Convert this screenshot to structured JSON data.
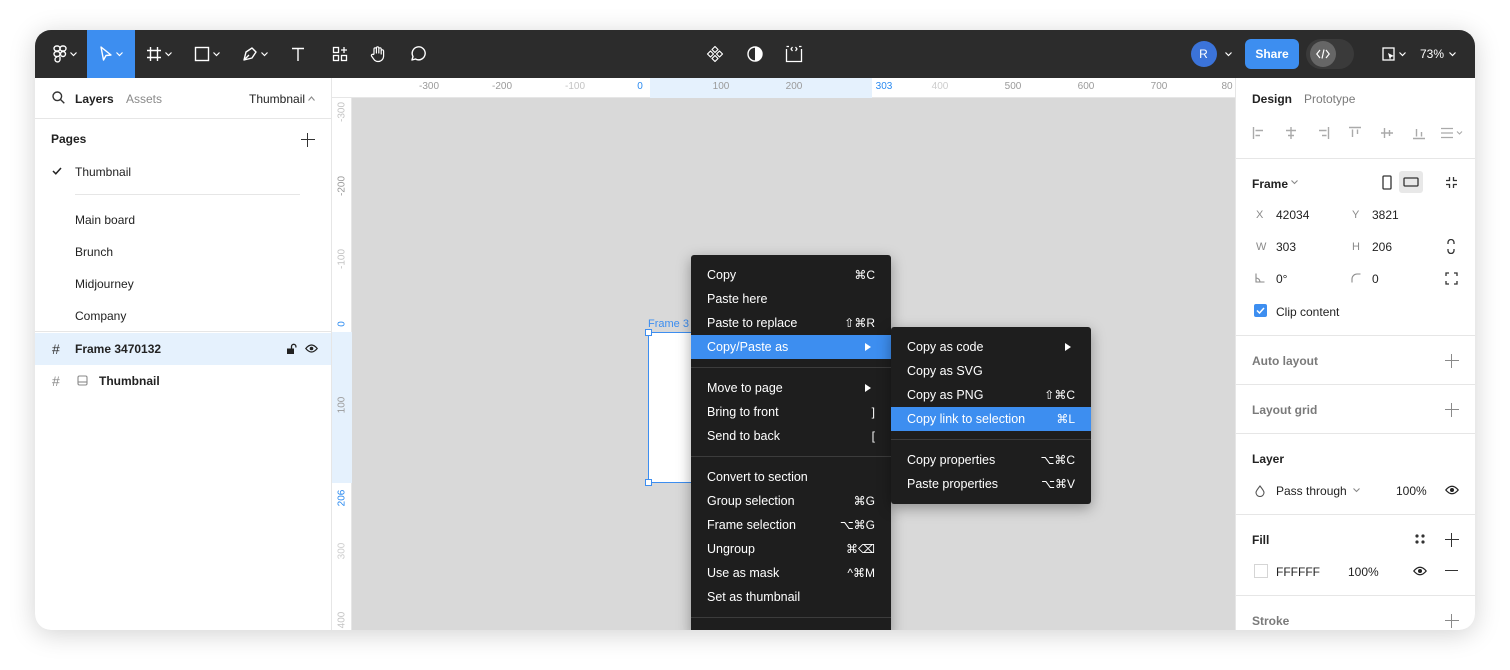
{
  "toolbar": {
    "tools": [
      "figma-menu-icon",
      "move-tool-icon",
      "frame-tool-icon",
      "shape-tool-icon",
      "pen-tool-icon",
      "text-tool-icon",
      "resources-icon",
      "hand-tool-icon",
      "comment-tool-icon"
    ],
    "center": [
      "components-icon",
      "contrast-icon",
      "code-layout-icon"
    ],
    "avatar_initial": "R",
    "share_label": "Share",
    "zoom": "73%"
  },
  "left_panel": {
    "tabs": {
      "layers": "Layers",
      "assets": "Assets",
      "page_selector": "Thumbnail"
    },
    "pages_title": "Pages",
    "pages": [
      "Thumbnail",
      "Main board",
      "Brunch",
      "Midjourney",
      "Company"
    ],
    "current_page": "Thumbnail",
    "layers": [
      {
        "name": "Frame 3470132",
        "selected": true
      },
      {
        "name": "Thumbnail",
        "selected": false
      }
    ]
  },
  "rulers": {
    "top": [
      "-300",
      "-200",
      "-100",
      "0",
      "100",
      "200",
      "303",
      "400",
      "500",
      "600",
      "700",
      "80"
    ],
    "left": [
      "-300",
      "-200",
      "-100",
      "0",
      "100",
      "206",
      "300",
      "400"
    ]
  },
  "canvas": {
    "frame_label": "Frame 3"
  },
  "context_menu": {
    "items": [
      {
        "label": "Copy",
        "shortcut": "⌘C"
      },
      {
        "label": "Paste here",
        "shortcut": ""
      },
      {
        "label": "Paste to replace",
        "shortcut": "⇧⌘R"
      },
      {
        "label": "Copy/Paste as",
        "shortcut": "",
        "submenu": true,
        "highlighted": true
      },
      {
        "label": "Move to page",
        "shortcut": "",
        "submenu": true
      },
      {
        "label": "Bring to front",
        "shortcut": "]"
      },
      {
        "label": "Send to back",
        "shortcut": "["
      },
      {
        "label": "Convert to section",
        "shortcut": ""
      },
      {
        "label": "Group selection",
        "shortcut": "⌘G"
      },
      {
        "label": "Frame selection",
        "shortcut": "⌥⌘G"
      },
      {
        "label": "Ungroup",
        "shortcut": "⌘⌫"
      },
      {
        "label": "Use as mask",
        "shortcut": "^⌘M"
      },
      {
        "label": "Set as thumbnail",
        "shortcut": ""
      }
    ]
  },
  "submenu": {
    "items": [
      {
        "label": "Copy as code",
        "shortcut": "",
        "submenu": true
      },
      {
        "label": "Copy as SVG",
        "shortcut": ""
      },
      {
        "label": "Copy as PNG",
        "shortcut": "⇧⌘C"
      },
      {
        "label": "Copy link to selection",
        "shortcut": "⌘L",
        "highlighted": true
      },
      {
        "label": "Copy properties",
        "shortcut": "⌥⌘C"
      },
      {
        "label": "Paste properties",
        "shortcut": "⌥⌘V"
      }
    ]
  },
  "right_panel": {
    "tabs": {
      "design": "Design",
      "prototype": "Prototype"
    },
    "frame": {
      "title": "Frame",
      "x_label": "X",
      "x": "42034",
      "y_label": "Y",
      "y": "3821",
      "w_label": "W",
      "w": "303",
      "h_label": "H",
      "h": "206",
      "rotation": "0°",
      "radius": "0",
      "clip_content": "Clip content"
    },
    "auto_layout": "Auto layout",
    "layout_grid": "Layout grid",
    "layer": {
      "title": "Layer",
      "blend": "Pass through",
      "opacity": "100%"
    },
    "fill": {
      "title": "Fill",
      "hex": "FFFFFF",
      "opacity": "100%"
    },
    "stroke": "Stroke"
  },
  "colors": {
    "accent": "#3d8ef0",
    "toolbar_bg": "#2c2c2c",
    "menu_bg": "#1e1e1e",
    "selection_bg": "#e5f1fd"
  }
}
